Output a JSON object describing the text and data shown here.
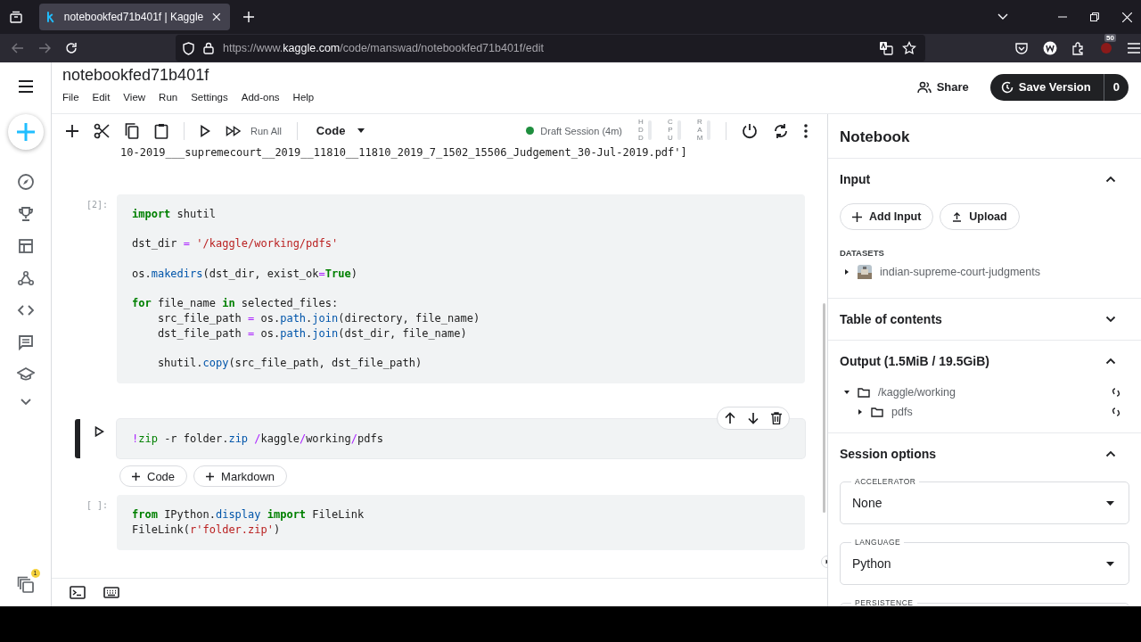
{
  "browser": {
    "tabs": [
      {
        "title": "notebookfed71b401f | Kaggle",
        "selected": true
      }
    ],
    "url": {
      "scheme": "https://www.",
      "domain": "kaggle.com",
      "path": "/code/manswad/notebookfed71b401f/edit"
    },
    "extension_badge": "50"
  },
  "header": {
    "title": "notebookfed71b401f",
    "menu": [
      "File",
      "Edit",
      "View",
      "Run",
      "Settings",
      "Add-ons",
      "Help"
    ],
    "share": "Share",
    "save_version": "Save Version",
    "version_count": "0"
  },
  "toolbar": {
    "run_all": "Run All",
    "cell_type": "Code",
    "session": "Draft Session (4m)",
    "meters": [
      "HDD",
      "CPU",
      "RAM"
    ]
  },
  "output_text": "10-2019___supremecourt__2019__11810__11810_2019_7_1502_15506_Judgement_30-Jul-2019.pdf']",
  "notebook": [
    {
      "kind": "cell",
      "prompt": "[2]:",
      "selected": false,
      "lines": [
        {
          "blank_after": true,
          "tokens": [
            {
              "text": "import",
              "kind": "kw"
            },
            {
              "text": " shutil",
              "kind": "plain"
            }
          ]
        },
        {
          "blank_after": true,
          "tokens": [
            {
              "text": "dst_dir ",
              "kind": "plain"
            },
            {
              "text": "=",
              "kind": "op"
            },
            {
              "text": " '/kaggle/working/pdfs'",
              "kind": "str"
            }
          ]
        },
        {
          "blank_after": true,
          "tokens": [
            {
              "text": "os.",
              "kind": "plain"
            },
            {
              "text": "makedirs",
              "kind": "attr"
            },
            {
              "text": "(dst_dir, exist_ok",
              "kind": "plain"
            },
            {
              "text": "=",
              "kind": "op"
            },
            {
              "text": "True",
              "kind": "kw"
            },
            {
              "text": ")",
              "kind": "plain"
            }
          ]
        },
        {
          "blank_after": false,
          "tokens": [
            {
              "text": "for",
              "kind": "kw"
            },
            {
              "text": " file_name ",
              "kind": "plain"
            },
            {
              "text": "in",
              "kind": "kw"
            },
            {
              "text": " selected_files:",
              "kind": "plain"
            }
          ]
        },
        {
          "blank_after": false,
          "tokens": [
            {
              "text": "    src_file_path ",
              "kind": "plain"
            },
            {
              "text": "=",
              "kind": "op"
            },
            {
              "text": " os.",
              "kind": "plain"
            },
            {
              "text": "path",
              "kind": "attr"
            },
            {
              "text": ".",
              "kind": "plain"
            },
            {
              "text": "join",
              "kind": "attr"
            },
            {
              "text": "(directory, file_name)",
              "kind": "plain"
            }
          ]
        },
        {
          "blank_after": true,
          "tokens": [
            {
              "text": "    dst_file_path ",
              "kind": "plain"
            },
            {
              "text": "=",
              "kind": "op"
            },
            {
              "text": " os.",
              "kind": "plain"
            },
            {
              "text": "path",
              "kind": "attr"
            },
            {
              "text": ".",
              "kind": "plain"
            },
            {
              "text": "join",
              "kind": "attr"
            },
            {
              "text": "(dst_dir, file_name)",
              "kind": "plain"
            }
          ]
        },
        {
          "blank_after": false,
          "tokens": [
            {
              "text": "    shutil.",
              "kind": "plain"
            },
            {
              "text": "copy",
              "kind": "attr"
            },
            {
              "text": "(src_file_path, dst_file_path)",
              "kind": "plain"
            }
          ]
        }
      ]
    },
    {
      "kind": "cell",
      "selected": true,
      "lines": [
        {
          "blank_after": false,
          "tokens": [
            {
              "text": "!",
              "kind": "op"
            },
            {
              "text": "zip",
              "kind": "cmd"
            },
            {
              "text": " -r folder.",
              "kind": "plain"
            },
            {
              "text": "zip",
              "kind": "attr"
            },
            {
              "text": " /",
              "kind": "op"
            },
            {
              "text": "kaggle",
              "kind": "plain"
            },
            {
              "text": "/",
              "kind": "op"
            },
            {
              "text": "working",
              "kind": "plain"
            },
            {
              "text": "/",
              "kind": "op"
            },
            {
              "text": "pdfs",
              "kind": "plain"
            }
          ]
        }
      ]
    },
    {
      "kind": "add_bar",
      "buttons": [
        "Code",
        "Markdown"
      ]
    },
    {
      "kind": "cell",
      "prompt": "[ ]:",
      "selected": false,
      "lines": [
        {
          "blank_after": false,
          "tokens": [
            {
              "text": "from",
              "kind": "kw"
            },
            {
              "text": " IPython.",
              "kind": "plain"
            },
            {
              "text": "display",
              "kind": "attr"
            },
            {
              "text": " import",
              "kind": "kw"
            },
            {
              "text": " FileLink",
              "kind": "plain"
            }
          ]
        },
        {
          "blank_after": false,
          "tokens": [
            {
              "text": "FileLink(",
              "kind": "plain"
            },
            {
              "text": "r'folder.zip'",
              "kind": "str"
            },
            {
              "text": ")",
              "kind": "plain"
            }
          ]
        }
      ]
    }
  ],
  "rail": {
    "notification_count": "1"
  },
  "panel": {
    "title": "Notebook",
    "sections": [
      {
        "kind": "input",
        "title": "Input",
        "expanded": true,
        "buttons": [
          "Add Input",
          "Upload"
        ],
        "datasets_label": "DATASETS",
        "datasets": [
          {
            "name": "indian-supreme-court-judgments",
            "expanded": false
          }
        ]
      },
      {
        "title": "Table of contents",
        "expanded": false
      },
      {
        "kind": "output",
        "title": "Output (1.5MiB / 19.5GiB)",
        "expanded": true,
        "tree": [
          {
            "name": "/kaggle/working",
            "expanded": true,
            "children": [
              {
                "name": "pdfs",
                "expanded": false
              }
            ]
          }
        ]
      },
      {
        "kind": "session",
        "title": "Session options",
        "expanded": true,
        "fields": [
          {
            "label": "ACCELERATOR",
            "value": "None"
          },
          {
            "label": "LANGUAGE",
            "value": "Python"
          },
          {
            "label": "PERSISTENCE"
          }
        ]
      }
    ]
  }
}
